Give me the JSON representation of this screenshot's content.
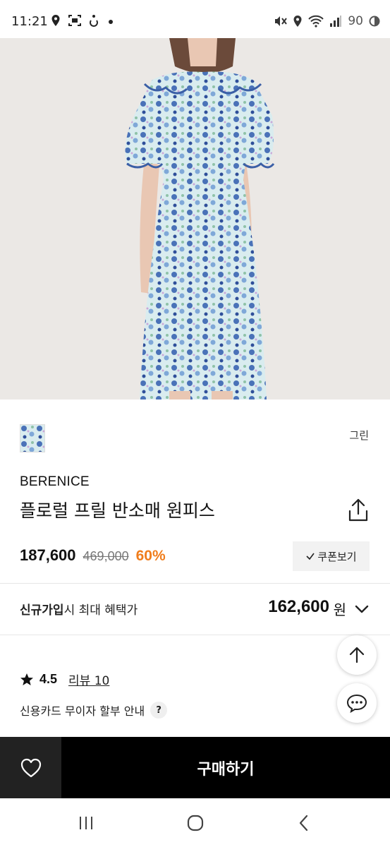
{
  "status_bar": {
    "time": "11:21",
    "battery": "90",
    "icons": [
      "location-icon",
      "screenshot-icon",
      "accessibility-icon",
      "dot-icon",
      "mute-icon",
      "location-icon",
      "wifi-icon",
      "signal-icon",
      "battery-icon"
    ]
  },
  "product": {
    "color_label": "그린",
    "brand": "BERENICE",
    "title": "플로럴 프릴 반소매 원피스",
    "price": "187,600",
    "original_price": "469,000",
    "discount": "60%",
    "coupon_label": "쿠폰보기"
  },
  "benefit": {
    "label_bold": "신규가입",
    "label_rest": "시 최대 혜택가",
    "price": "162,600",
    "unit": "원"
  },
  "rating": {
    "value": "4.5",
    "review_label": "리뷰 10"
  },
  "installment": {
    "label": "신용카드 무이자 할부 안내",
    "help": "?"
  },
  "bottom": {
    "buy_label": "구매하기"
  },
  "colors": {
    "discount": "#f07d1c",
    "buy_bg": "#000000",
    "wish_bg": "#222222"
  }
}
